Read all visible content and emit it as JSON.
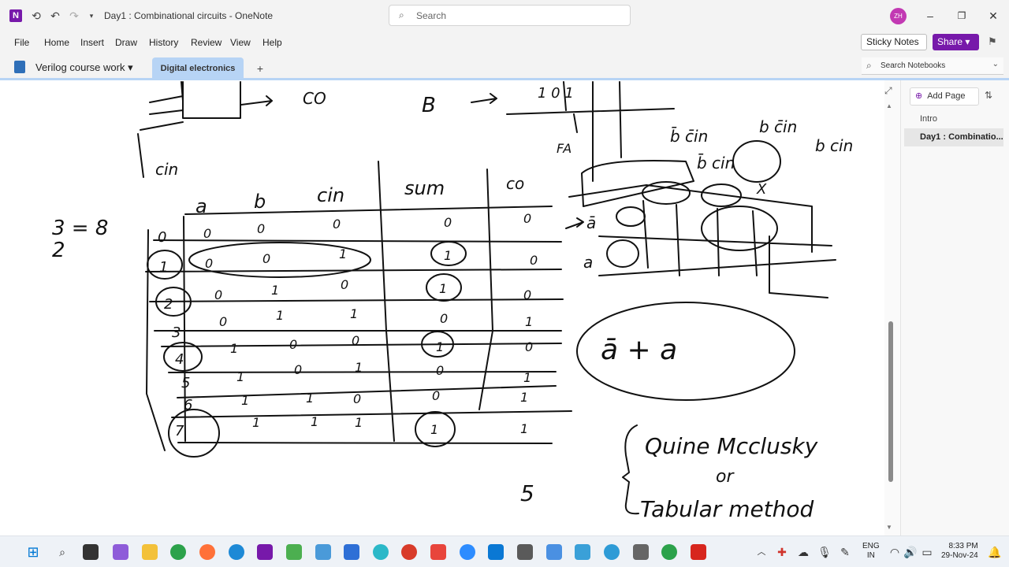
{
  "app": {
    "title": "Day1 : Combinational circuits  -  OneNote",
    "logo_icon": "onenote-logo-icon"
  },
  "search": {
    "placeholder": "Search"
  },
  "user": {
    "initials": "ZH",
    "color": "#c239b3"
  },
  "menu": {
    "items": [
      "File",
      "Home",
      "Insert",
      "Draw",
      "History",
      "Review",
      "View",
      "Help"
    ],
    "sticky_notes": "Sticky Notes",
    "share": "Share"
  },
  "notebook": {
    "name": "Verilog course work",
    "section_tab": "Digital electronics",
    "add_section": "+",
    "search_placeholder": "Search Notebooks"
  },
  "pages": {
    "add_page": "Add Page",
    "list": [
      "Intro",
      "Day1 : Combinatio..."
    ],
    "selected_index": 1
  },
  "ink": {
    "top_labels": [
      "CO",
      "B",
      "cin",
      "FA"
    ],
    "equation": "3 = 8",
    "equation_base": "2",
    "table_headers": [
      "a",
      "b",
      "cin",
      "sum",
      "co"
    ],
    "row_numbers": [
      "0",
      "1",
      "2",
      "3",
      "4",
      "5",
      "6",
      "7"
    ],
    "truth_a": [
      "0",
      "0",
      "0",
      "0",
      "1",
      "1",
      "1",
      "1"
    ],
    "truth_b": [
      "0",
      "0",
      "1",
      "1",
      "0",
      "0",
      "1",
      "1"
    ],
    "truth_cin": [
      "0",
      "1",
      "0",
      "1",
      "0",
      "1",
      "0",
      "1"
    ],
    "truth_sum": [
      "0",
      "1",
      "1",
      "0",
      "1",
      "0",
      "0",
      "1"
    ],
    "truth_co": [
      "0",
      "0",
      "0",
      "1",
      "0",
      "1",
      "1",
      "1"
    ],
    "kmap_cols": [
      "b̄ c̄in",
      "b̄ cin",
      "b cin",
      "b c̄in"
    ],
    "kmap_rows": [
      "ā",
      "a"
    ],
    "result_expr": "ā + a",
    "note_line1": "Quine Mcclusky",
    "note_line2": "or",
    "note_line3": "Tabular method",
    "number_five": "5"
  },
  "taskbar": {
    "lang_line1": "ENG",
    "lang_line2": "IN",
    "time": "8:33 PM",
    "date": "29-Nov-24"
  },
  "colors": {
    "brand": "#7719aa",
    "section_tab": "#b7d4f5",
    "chrome": "#f3f3f3"
  }
}
